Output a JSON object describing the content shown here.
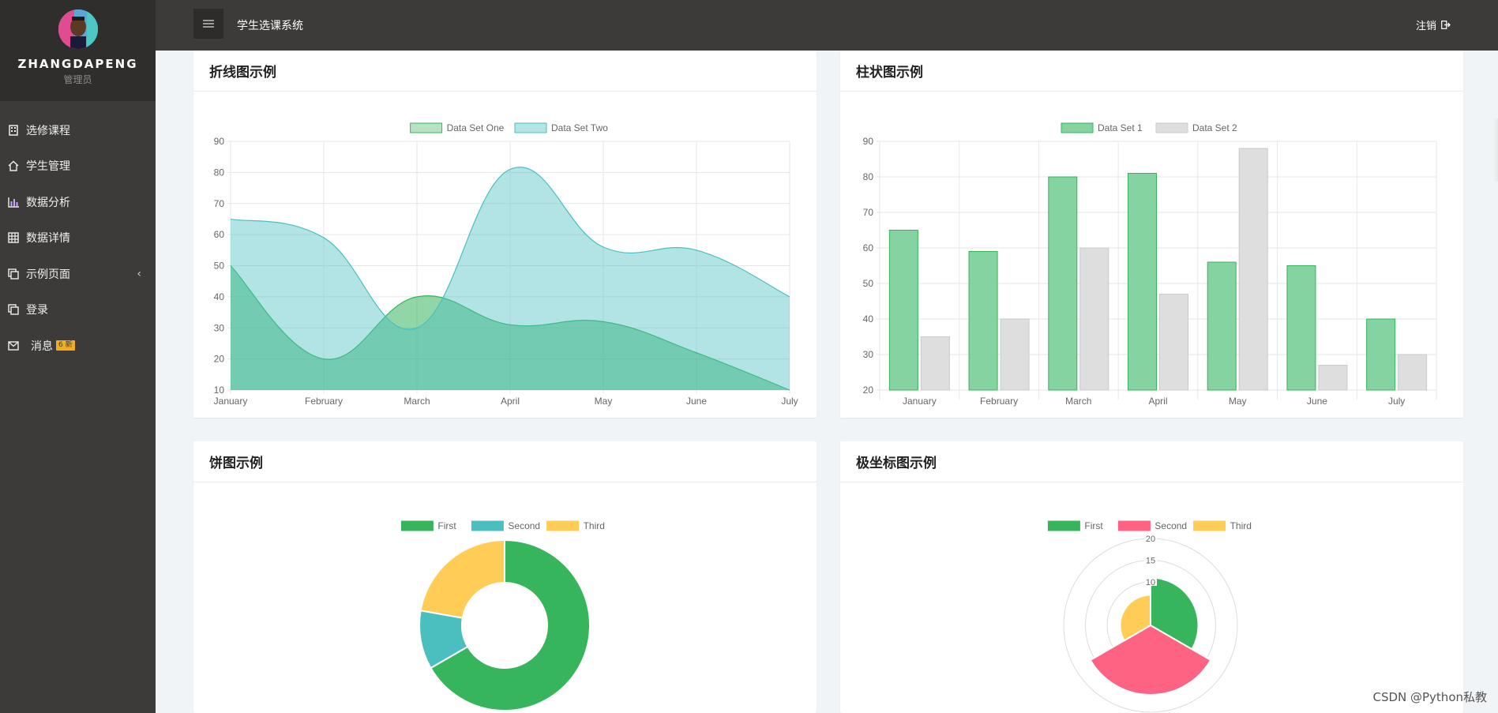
{
  "sidebar": {
    "username": "ZHANGDAPENG",
    "role": "管理员",
    "items": [
      {
        "label": "选修课程",
        "icon": "building-icon"
      },
      {
        "label": "学生管理",
        "icon": "home-icon"
      },
      {
        "label": "数据分析",
        "icon": "bar-chart-icon"
      },
      {
        "label": "数据详情",
        "icon": "table-icon"
      },
      {
        "label": "示例页面",
        "icon": "copy-icon"
      },
      {
        "label": "登录",
        "icon": "copy-icon"
      },
      {
        "label": "消息",
        "icon": "mail-icon",
        "badge": "6 新"
      }
    ]
  },
  "header": {
    "app_title": "学生选课系统",
    "logout_label": "注销"
  },
  "cards": {
    "line": {
      "title": "折线图示例"
    },
    "bar": {
      "title": "柱状图示例"
    },
    "pie": {
      "title": "饼图示例"
    },
    "polar": {
      "title": "极坐标图示例"
    }
  },
  "watermark": "CSDN @Python私教",
  "colors": {
    "green": "#36b55c",
    "green_fill": "#84d3a9",
    "teal": "#4bbfc0",
    "teal_fill": "#b3e5e5",
    "grey_fill": "#dcdcdc",
    "yellow": "#ffcd56",
    "pink": "#ff6384",
    "sidebar_bg": "#3c3b3a"
  },
  "chart_data": [
    {
      "type": "area",
      "categories": [
        "January",
        "February",
        "March",
        "April",
        "May",
        "June",
        "July"
      ],
      "ylim": [
        10,
        90
      ],
      "yticks": [
        10,
        20,
        30,
        40,
        50,
        60,
        70,
        80,
        90
      ],
      "legend_position": "top",
      "series": [
        {
          "name": "Data Set One",
          "values": [
            50,
            20,
            40,
            31,
            32,
            22,
            10
          ]
        },
        {
          "name": "Data Set Two",
          "values": [
            65,
            59,
            30,
            81,
            56,
            55,
            40
          ]
        }
      ]
    },
    {
      "type": "bar",
      "categories": [
        "January",
        "February",
        "March",
        "April",
        "May",
        "June",
        "July"
      ],
      "ylim": [
        20,
        90
      ],
      "yticks": [
        20,
        30,
        40,
        50,
        60,
        70,
        80,
        90
      ],
      "legend_position": "top",
      "series": [
        {
          "name": "Data Set 1",
          "values": [
            65,
            59,
            80,
            81,
            56,
            55,
            40
          ]
        },
        {
          "name": "Data Set 2",
          "values": [
            35,
            40,
            60,
            47,
            88,
            27,
            30
          ]
        }
      ]
    },
    {
      "type": "pie",
      "doughnut": true,
      "legend_position": "top",
      "labels": [
        "First",
        "Second",
        "Third"
      ],
      "values": [
        300,
        50,
        100
      ]
    },
    {
      "type": "polar",
      "legend_position": "top",
      "labels": [
        "First",
        "Second",
        "Third"
      ],
      "values": [
        11,
        16,
        7
      ],
      "rticks": [
        5,
        10,
        15,
        20
      ]
    }
  ]
}
